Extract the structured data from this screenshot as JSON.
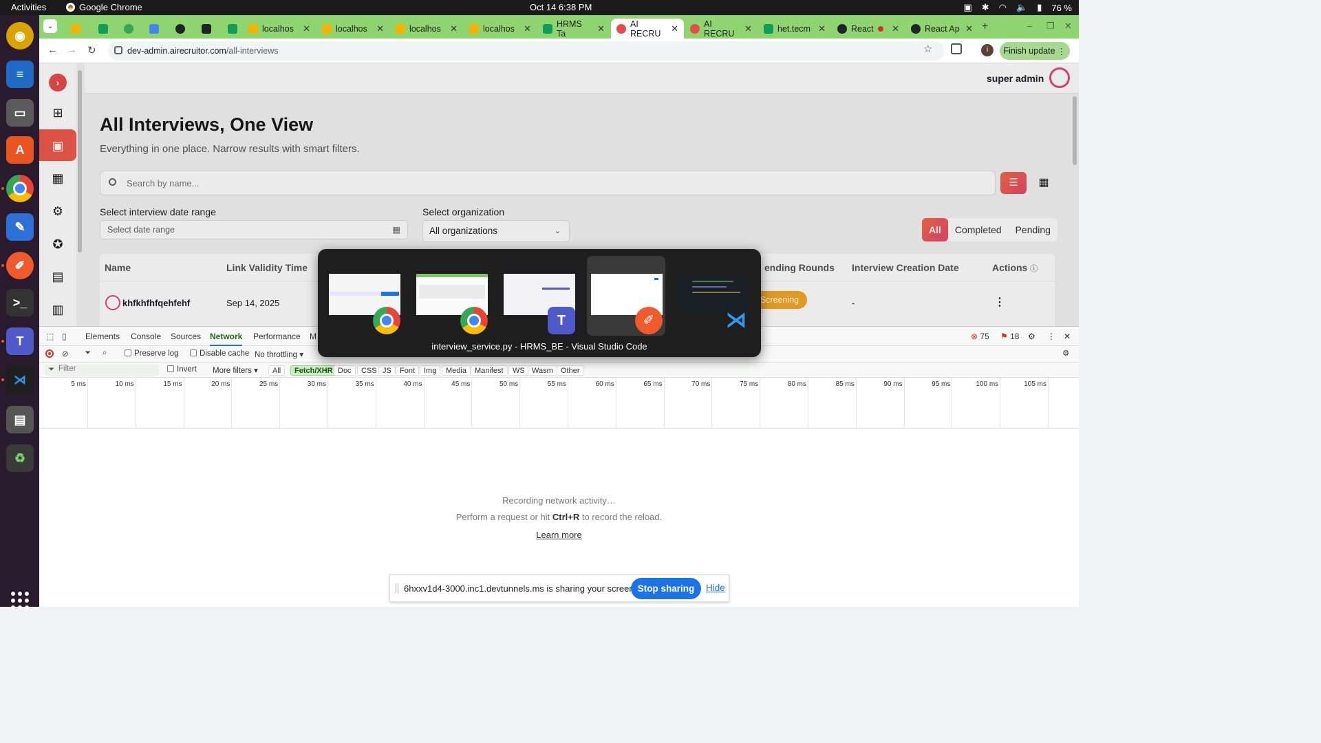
{
  "topbar": {
    "activities": "Activities",
    "app_name": "Google Chrome",
    "clock": "Oct 14  6:38 PM",
    "battery": "76 %"
  },
  "tabs": [
    {
      "label": "",
      "color": "#f4b400"
    },
    {
      "label": "",
      "color": "#0f9d58"
    },
    {
      "label": "",
      "color": "#34a853"
    },
    {
      "label": "",
      "color": "#4285f4"
    },
    {
      "label": "",
      "color": "#222222"
    },
    {
      "label": "",
      "color": "#222222"
    },
    {
      "label": "",
      "color": "#0f9d58"
    },
    {
      "label": "localhos",
      "color": "#f4b400"
    },
    {
      "label": "localhos",
      "color": "#f4b400"
    },
    {
      "label": "localhos",
      "color": "#f4b400"
    },
    {
      "label": "localhos",
      "color": "#f4b400"
    },
    {
      "label": "HRMS Ta",
      "color": "#0f9d58"
    },
    {
      "label": "AI RECRU",
      "color": "#e94b4b"
    },
    {
      "label": "AI RECRU",
      "color": "#e94b4b"
    },
    {
      "label": "het.tecm",
      "color": "#0f9d58"
    },
    {
      "label": "React",
      "color": "#20232a"
    },
    {
      "label": "React Ap",
      "color": "#20232a"
    }
  ],
  "toolbar": {
    "url_host": "dev-admin.airecruitor.com",
    "url_path": "/all-interviews",
    "profile_initial": "i",
    "finish_update": "Finish update"
  },
  "page": {
    "user": "super admin",
    "title": "All Interviews, One View",
    "subtitle": "Everything in one place. Narrow results with smart filters.",
    "search_placeholder": "Search by name...",
    "date_label": "Select interview date range",
    "date_placeholder": "Select date range",
    "org_label": "Select organization",
    "org_value": "All organizations",
    "filters": [
      "All",
      "Completed",
      "Pending"
    ],
    "columns": {
      "name": "Name",
      "link_validity": "Link Validity Time",
      "pending_rounds": "ending Rounds",
      "creation_date": "Interview Creation Date",
      "actions": "Actions"
    },
    "rows": [
      {
        "name": "khfkhfhfqehfehf",
        "validity": "Sep 14, 2025",
        "status": "Screening",
        "created": "-"
      }
    ]
  },
  "devtools": {
    "tabs": [
      "Elements",
      "Console",
      "Sources",
      "Network",
      "Performance",
      "M"
    ],
    "errors": "75",
    "warnings": "18",
    "preserve_log": "Preserve log",
    "disable_cache": "Disable cache",
    "throttling": "No throttling",
    "filter_placeholder": "Filter",
    "invert": "Invert",
    "more_filters": "More filters",
    "type_filters": [
      "All",
      "Fetch/XHR",
      "Doc",
      "CSS",
      "JS",
      "Font",
      "Img",
      "Media",
      "Manifest",
      "WS",
      "Wasm",
      "Other"
    ],
    "timeline_ticks": [
      "5 ms",
      "10 ms",
      "15 ms",
      "20 ms",
      "25 ms",
      "30 ms",
      "35 ms",
      "40 ms",
      "45 ms",
      "50 ms",
      "55 ms",
      "60 ms",
      "65 ms",
      "70 ms",
      "75 ms",
      "80 ms",
      "85 ms",
      "90 ms",
      "95 ms",
      "100 ms",
      "105 ms"
    ],
    "recording": "Recording network activity…",
    "hint_pre": "Perform a request or hit ",
    "hint_key": "Ctrl+R",
    "hint_post": " to record the reload.",
    "learn_more": "Learn more"
  },
  "switcher": {
    "caption": "interview_service.py - HRMS_BE - Visual Studio Code",
    "apps": [
      "chrome",
      "chrome",
      "teams-for-linux",
      "drawing",
      "vscode"
    ]
  },
  "sharebar": {
    "message": "6hxxv1d4-3000.inc1.devtunnels.ms is sharing your screen.",
    "stop": "Stop sharing",
    "hide": "Hide"
  },
  "colors": {
    "brand_gradient_start": "#f36b45",
    "brand_gradient_end": "#e9466e",
    "status_screening": "#f5a623",
    "chrome_theme": "#8ed46f"
  }
}
